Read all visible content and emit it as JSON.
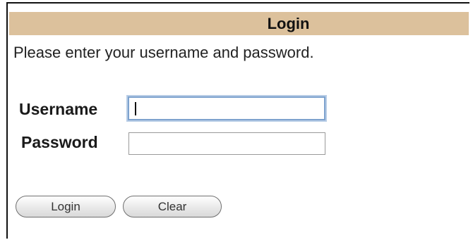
{
  "header": {
    "title": "Login"
  },
  "instructions": "Please enter your username and password.",
  "form": {
    "username_label": "Username",
    "username_value": "",
    "password_label": "Password",
    "password_value": ""
  },
  "buttons": {
    "login_label": "Login",
    "clear_label": "Clear"
  },
  "colors": {
    "header_background": "#dcc19c",
    "focus_ring": "#7da2ce"
  }
}
